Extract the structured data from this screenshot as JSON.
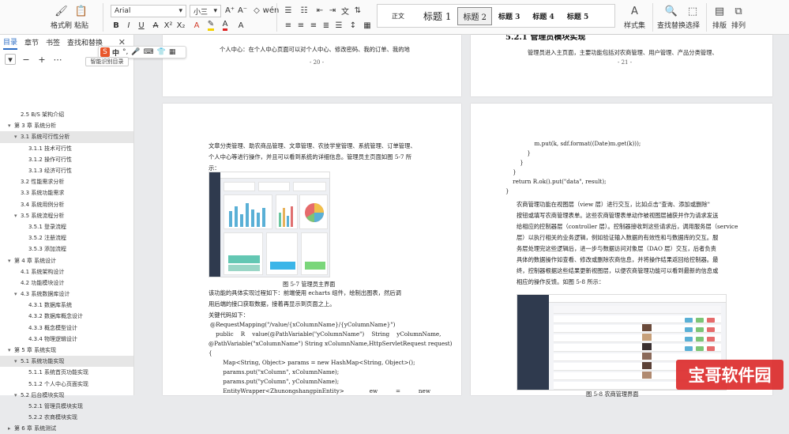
{
  "ribbon": {
    "format_painter": "格式刷",
    "paste": "粘贴",
    "font_name": "Arial",
    "font_size": "小三",
    "styles": [
      "正文",
      "标题 1",
      "标题 2",
      "标题 3",
      "标题 4",
      "标题 5"
    ],
    "selected_style": "标题 2",
    "styles_set": "样式集",
    "find_replace": "查找替换",
    "select": "选择",
    "layout": "排版",
    "arrange": "排列"
  },
  "nav": {
    "tabs": [
      "目录",
      "章节",
      "书签",
      "查找和替换"
    ],
    "active_tab": "目录",
    "ime_label": "中",
    "ime_tooltip": "智能识别目录",
    "toc": [
      {
        "text": "2.5 B/S 架构介绍",
        "level": 2,
        "caret": "",
        "hl": false
      },
      {
        "text": "第 3 章  系统分析",
        "level": 1,
        "caret": "▾",
        "hl": false
      },
      {
        "text": "3.1  系统可行性分析",
        "level": 2,
        "caret": "▾",
        "hl": true
      },
      {
        "text": "3.1.1  技术可行性",
        "level": 3,
        "caret": "",
        "hl": false
      },
      {
        "text": "3.1.2  操作可行性",
        "level": 3,
        "caret": "",
        "hl": false
      },
      {
        "text": "3.1.3  经济可行性",
        "level": 3,
        "caret": "",
        "hl": false
      },
      {
        "text": "3.2  性能需求分析",
        "level": 2,
        "caret": "",
        "hl": false
      },
      {
        "text": "3.3  系统功能需求",
        "level": 2,
        "caret": "",
        "hl": false
      },
      {
        "text": "3.4  系统用例分析",
        "level": 2,
        "caret": "",
        "hl": false
      },
      {
        "text": "3.5  系统流程分析",
        "level": 2,
        "caret": "▾",
        "hl": false
      },
      {
        "text": "3.5.1  登录流程",
        "level": 3,
        "caret": "",
        "hl": false
      },
      {
        "text": "3.5.2  注册流程",
        "level": 3,
        "caret": "",
        "hl": false
      },
      {
        "text": "3.5.3  添加流程",
        "level": 3,
        "caret": "",
        "hl": false
      },
      {
        "text": "第 4 章  系统设计",
        "level": 1,
        "caret": "▾",
        "hl": false
      },
      {
        "text": "4.1  系统架构设计",
        "level": 2,
        "caret": "",
        "hl": false
      },
      {
        "text": "4.2  功能模块设计",
        "level": 2,
        "caret": "",
        "hl": false
      },
      {
        "text": "4.3  系统数据库设计",
        "level": 2,
        "caret": "▾",
        "hl": false
      },
      {
        "text": "4.3.1  数据库系统",
        "level": 3,
        "caret": "",
        "hl": false
      },
      {
        "text": "4.3.2  数据库概念设计",
        "level": 3,
        "caret": "",
        "hl": false
      },
      {
        "text": "4.3.3  概念模型设计",
        "level": 3,
        "caret": "",
        "hl": false
      },
      {
        "text": "4.3.4  物理逻辑设计",
        "level": 3,
        "caret": "",
        "hl": false
      },
      {
        "text": "第 5 章  系统实现",
        "level": 1,
        "caret": "▾",
        "hl": false
      },
      {
        "text": "5.1  系统功能实现",
        "level": 2,
        "caret": "▾",
        "hl": true
      },
      {
        "text": "5.1.1  系统首页功能实现",
        "level": 3,
        "caret": "",
        "hl": false
      },
      {
        "text": "5.1.2  个人中心页面实现",
        "level": 3,
        "caret": "",
        "hl": false
      },
      {
        "text": "5.2  后台模块实现",
        "level": 2,
        "caret": "▾",
        "hl": false
      },
      {
        "text": "5.2.1  管理员模块实现",
        "level": 3,
        "caret": "",
        "hl": false
      },
      {
        "text": "5.2.2  农商模块实现",
        "level": 3,
        "caret": "",
        "hl": false
      },
      {
        "text": "第 6 章  系统测试",
        "level": 1,
        "caret": "▸",
        "hl": false
      }
    ]
  },
  "pages": {
    "top_left_text": "个人中心：在个人中心页面可以对个人中心、修改密码、我的订单、我的地",
    "top_left_pagenum": "- 20 -",
    "top_right_heading": "5.2.1 管理员模块实现",
    "top_right_text": "管理员进入主页面，主要功能包括对农商管理、用户管理、产品分类管理、",
    "top_right_pagenum": "- 21 -",
    "left_intro": [
      "文章分类管理、助农商品管理、文章管理、农技学堂管理、系统管理、订单管理、",
      "个人中心等进行操作，并且可以看到系统的详细信息。管理员主页面如图 5-7 所",
      "示："
    ],
    "left_caption": "图 5-7  管理员主界面",
    "left_after": [
      "    该功能的具体实现过程如下：前端使用 echarts 组件，绘制出图表，然后调",
      "用后端的接口获取数据，接着再显示到页面之上。",
      "    关键代码如下："
    ],
    "left_code": [
      "@RequestMapping(\"/value/{xColumnName}/{yColumnName}\")",
      "    public    R    value(@PathVariable(\"yColumnName\")    String    yColumnName,",
      "@PathVariable(\"xColumnName\") String xColumnName,HttpServletRequest request)",
      "{",
      "        Map<String, Object> params = new HashMap<String, Object>();",
      "        params.put(\"xColumn\", xColumnName);",
      "        params.put(\"yColumn\", yColumnName);",
      "        EntityWrapper<ZhunongshangpinEntity>              ew          =          new",
      "EntityWrapper<ZhunongshangpinEntity>();"
    ],
    "right_code": [
      "                m.put(k, sdf.format((Date)m.get(k)));",
      "            }",
      "        }",
      "    }",
      "    return R.ok().put(\"data\", result);",
      "}"
    ],
    "right_text": [
      "    农商管理功能在视图层（view 层）进行交互，比如点击\"查询、添加或删除\"",
      "按钮或填写农商管理表单。这些农商管理表单动作被视图层捕获并作为请求发送",
      "给相应的控制器层（controller 层）。控制器接收到这些请求后，调用服务层（service",
      "层）以执行相关的业务逻辑，例如验证输入数据的有效性和与数据库的交互。服",
      "务层处理完这些逻辑后，进一步与数据访问对象层（DAO 层）交互，后者负责",
      "具体的数据操作如查看、修改或删除农商信息，并将操作结果返回给控制器。最",
      "终，控制器根据这些结果更新视图层，以便农商管理功能可以看到最新的信息或",
      "相应的操作反馈。如图 5-8 所示："
    ],
    "right_caption": "图 5-8  农商管理界面"
  },
  "watermark": "宝哥软件园",
  "colors": {
    "accent": "#2b6cc4",
    "sidebar_dark": "#2f3a4e",
    "highlight": "#e6e6e6"
  }
}
